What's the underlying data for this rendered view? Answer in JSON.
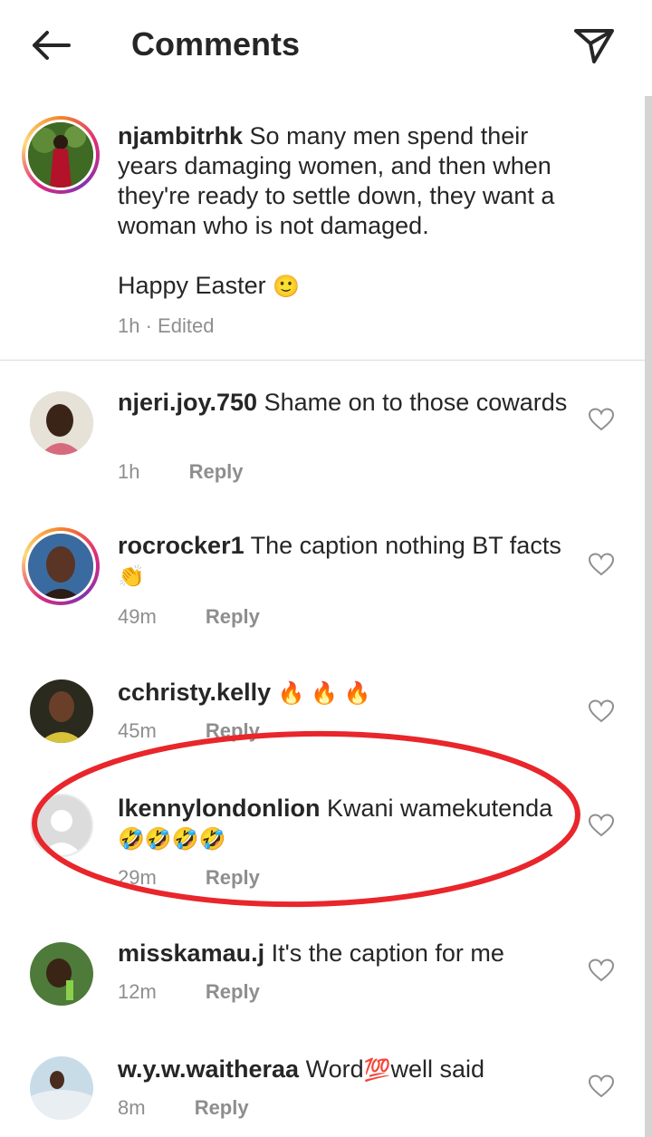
{
  "header": {
    "title": "Comments"
  },
  "caption": {
    "username": "njambitrhk",
    "text": "So many men spend their years damaging women, and then when they're ready to settle down, they want a woman who is not damaged.",
    "line2": "Happy Easter",
    "line2_emoji": "🙂",
    "time": "1h",
    "edited": "· Edited"
  },
  "reply_label": "Reply",
  "comments": [
    {
      "username": "njeri.joy.750",
      "text": "Shame on to those cowards",
      "emoji": "",
      "time": "1h"
    },
    {
      "username": "rocrocker1",
      "text": "The caption nothing BT facts",
      "emoji": "👏",
      "time": "49m"
    },
    {
      "username": "cchristy.kelly",
      "text": "",
      "emoji": "🔥 🔥 🔥",
      "time": "45m"
    },
    {
      "username": "lkennylondonlion",
      "text": "Kwani wamekutenda",
      "emoji": "🤣🤣🤣🤣",
      "time": "29m"
    },
    {
      "username": "misskamau.j",
      "text": "It's the caption for me",
      "emoji": "",
      "time": "12m"
    },
    {
      "username": "w.y.w.waitheraa",
      "text": "Word",
      "emoji": "💯",
      "text2": "well said",
      "time": "8m"
    }
  ],
  "colors": {
    "annotation": "#e8262b",
    "story_ring_start": "#f58529",
    "story_ring_end": "#dd2a7b",
    "muted": "#8e8e8e"
  }
}
